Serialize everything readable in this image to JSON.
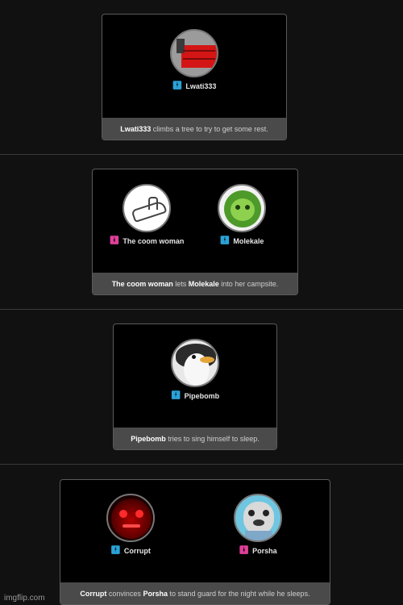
{
  "colors": {
    "background": "#111111",
    "card_background": "#000000",
    "caption_background": "#4a4a4a",
    "male_icon": "#2aa3d8",
    "female_icon": "#e0409a"
  },
  "events": [
    {
      "tributes": [
        {
          "name": "Lwati333",
          "gender": "male",
          "gender_icon": "male-icon",
          "avatar": "red-train-avatar"
        }
      ],
      "caption": {
        "parts": [
          {
            "text": "Lwati333",
            "bold": true
          },
          {
            "text": " climbs a tree to try to get some rest.",
            "bold": false
          }
        ]
      }
    },
    {
      "tributes": [
        {
          "name": "The coom woman",
          "gender": "female",
          "gender_icon": "female-icon",
          "avatar": "hand-gesture-avatar"
        },
        {
          "name": "Molekale",
          "gender": "male",
          "gender_icon": "male-icon",
          "avatar": "green-creature-avatar"
        }
      ],
      "caption": {
        "parts": [
          {
            "text": "The coom woman",
            "bold": true
          },
          {
            "text": " lets ",
            "bold": false
          },
          {
            "text": "Molekale",
            "bold": true
          },
          {
            "text": " into her campsite.",
            "bold": false
          }
        ]
      }
    },
    {
      "tributes": [
        {
          "name": "Pipebomb",
          "gender": "male",
          "gender_icon": "male-icon",
          "avatar": "penguin-avatar"
        }
      ],
      "caption": {
        "parts": [
          {
            "text": "Pipebomb",
            "bold": true
          },
          {
            "text": " tries to sing himself to sleep.",
            "bold": false
          }
        ]
      }
    },
    {
      "tributes": [
        {
          "name": "Corrupt",
          "gender": "male",
          "gender_icon": "male-icon",
          "avatar": "red-dark-face-avatar"
        },
        {
          "name": "Porsha",
          "gender": "female",
          "gender_icon": "female-icon",
          "avatar": "dog-avatar"
        }
      ],
      "caption": {
        "parts": [
          {
            "text": "Corrupt",
            "bold": true
          },
          {
            "text": " convinces ",
            "bold": false
          },
          {
            "text": "Porsha",
            "bold": true
          },
          {
            "text": " to stand guard for the night while he sleeps.",
            "bold": false
          }
        ]
      }
    }
  ],
  "watermark": "imgflip.com"
}
